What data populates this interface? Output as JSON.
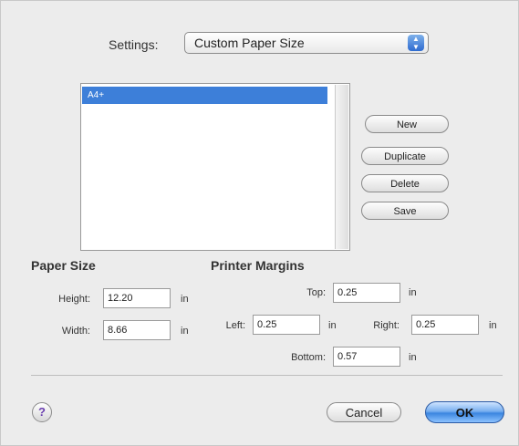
{
  "settings": {
    "label": "Settings:",
    "selected": "Custom Paper Size"
  },
  "paper_list": {
    "items": [
      "A4+"
    ],
    "selected_index": 0
  },
  "buttons": {
    "new": "New",
    "duplicate": "Duplicate",
    "delete": "Delete",
    "save": "Save"
  },
  "paper_size": {
    "title": "Paper Size",
    "height_label": "Height:",
    "height_value": "12.20",
    "width_label": "Width:",
    "width_value": "8.66",
    "unit": "in"
  },
  "margins": {
    "title": "Printer Margins",
    "top_label": "Top:",
    "top_value": "0.25",
    "left_label": "Left:",
    "left_value": "0.25",
    "right_label": "Right:",
    "right_value": "0.25",
    "bottom_label": "Bottom:",
    "bottom_value": "0.57",
    "unit": "in"
  },
  "footer": {
    "help": "?",
    "cancel": "Cancel",
    "ok": "OK"
  },
  "colors": {
    "selection": "#3d7fd9",
    "default_button": "#3b86e0",
    "help_mark": "#6b3fb0"
  }
}
